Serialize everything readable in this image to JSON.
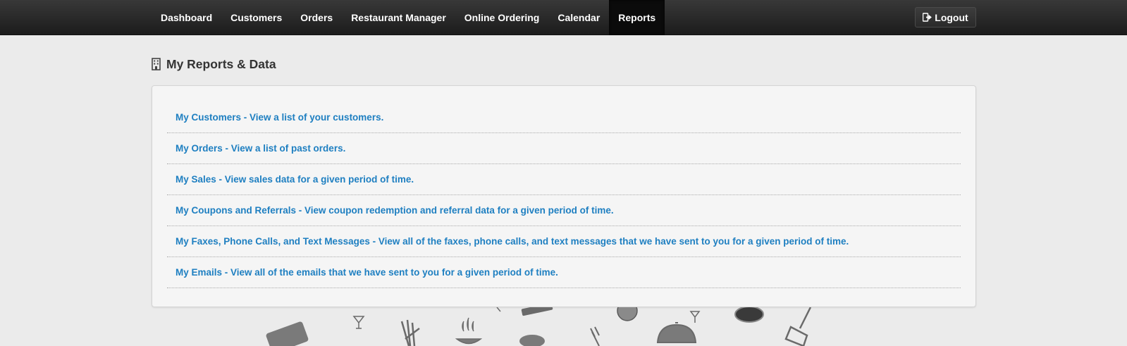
{
  "nav": {
    "items": [
      {
        "label": "Dashboard",
        "active": false
      },
      {
        "label": "Customers",
        "active": false
      },
      {
        "label": "Orders",
        "active": false
      },
      {
        "label": "Restaurant Manager",
        "active": false
      },
      {
        "label": "Online Ordering",
        "active": false
      },
      {
        "label": "Calendar",
        "active": false
      },
      {
        "label": "Reports",
        "active": true
      }
    ],
    "logout_label": "Logout"
  },
  "page": {
    "title": "My Reports & Data",
    "title_icon": "building-icon"
  },
  "reports": [
    {
      "label": "My Customers - View a list of your customers."
    },
    {
      "label": "My Orders - View a list of past orders."
    },
    {
      "label": "My Sales - View sales data for a given period of time."
    },
    {
      "label": "My Coupons and Referrals - View coupon redemption and referral data for a given period of time."
    },
    {
      "label": "My Faxes, Phone Calls, and Text Messages - View all of the faxes, phone calls, and text messages that we have sent to you for a given period of time."
    },
    {
      "label": "My Emails - View all of the emails that we have sent to you for a given period of time."
    }
  ],
  "colors": {
    "link": "#1e7fc1",
    "navbar": "#222222",
    "background": "#ebebeb"
  }
}
